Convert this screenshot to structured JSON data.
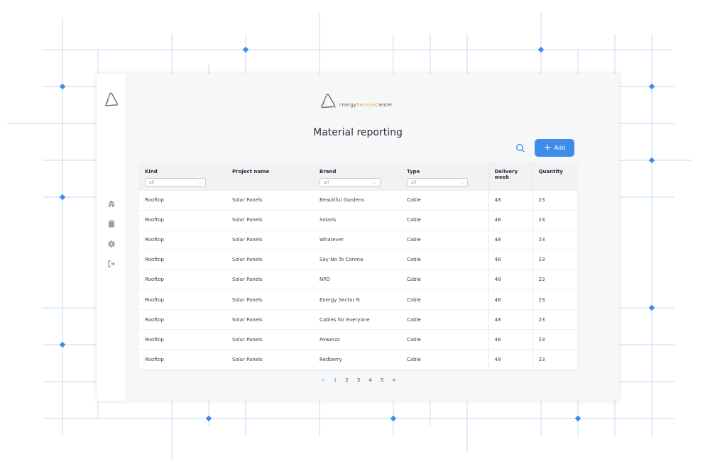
{
  "brand": {
    "part1": "E",
    "part2": "nergy",
    "part3": "Service",
    "part4": "C",
    "part5": "enter",
    "dark_color": "#555a62",
    "accent_color": "#f2a33a"
  },
  "page": {
    "title": "Material reporting"
  },
  "toolbar": {
    "add_label": "Add",
    "add_plus": "+"
  },
  "table": {
    "columns": [
      {
        "label": "Kind",
        "filter": "all"
      },
      {
        "label": "Project name"
      },
      {
        "label": "Brand",
        "filter": "all"
      },
      {
        "label": "Type",
        "filter": "all"
      },
      {
        "label": "Delivery week"
      },
      {
        "label": "Quantity"
      }
    ],
    "rows": [
      [
        "Rooftop",
        "Solar Panels",
        "Beautiful Gardens",
        "Cable",
        "48",
        "23"
      ],
      [
        "Rooftop",
        "Solar Panels",
        "Solaris",
        "Cable",
        "48",
        "23"
      ],
      [
        "Rooftop",
        "Solar Panels",
        "Whatever",
        "Cable",
        "48",
        "23"
      ],
      [
        "Rooftop",
        "Solar Panels",
        "Say No To Corona",
        "Cable",
        "48",
        "23"
      ],
      [
        "Rooftop",
        "Solar Panels",
        "NPD",
        "Cable",
        "48",
        "23"
      ],
      [
        "Rooftop",
        "Solar Panels",
        "Energy Sector N",
        "Cable",
        "48",
        "23"
      ],
      [
        "Rooftop",
        "Solar Panels",
        "Cables for Everyone",
        "Cable",
        "48",
        "23"
      ],
      [
        "Rooftop",
        "Solar Panels",
        "Powerzz",
        "Cable",
        "48",
        "23"
      ],
      [
        "Rooftop",
        "Solar Panels",
        "Redberry",
        "Cable",
        "48",
        "23"
      ]
    ]
  },
  "pagination": {
    "prev": "<",
    "pages": [
      "1",
      "2",
      "3",
      "4",
      "5"
    ],
    "next": ">",
    "current": "1"
  },
  "icons": {
    "nav": [
      "home-icon",
      "clipboard-icon",
      "gear-icon",
      "logout-icon"
    ],
    "search": "search-icon"
  },
  "colors": {
    "accent": "#3f8bea",
    "grid": "#bcd6f5",
    "node": "#3f8bea"
  }
}
